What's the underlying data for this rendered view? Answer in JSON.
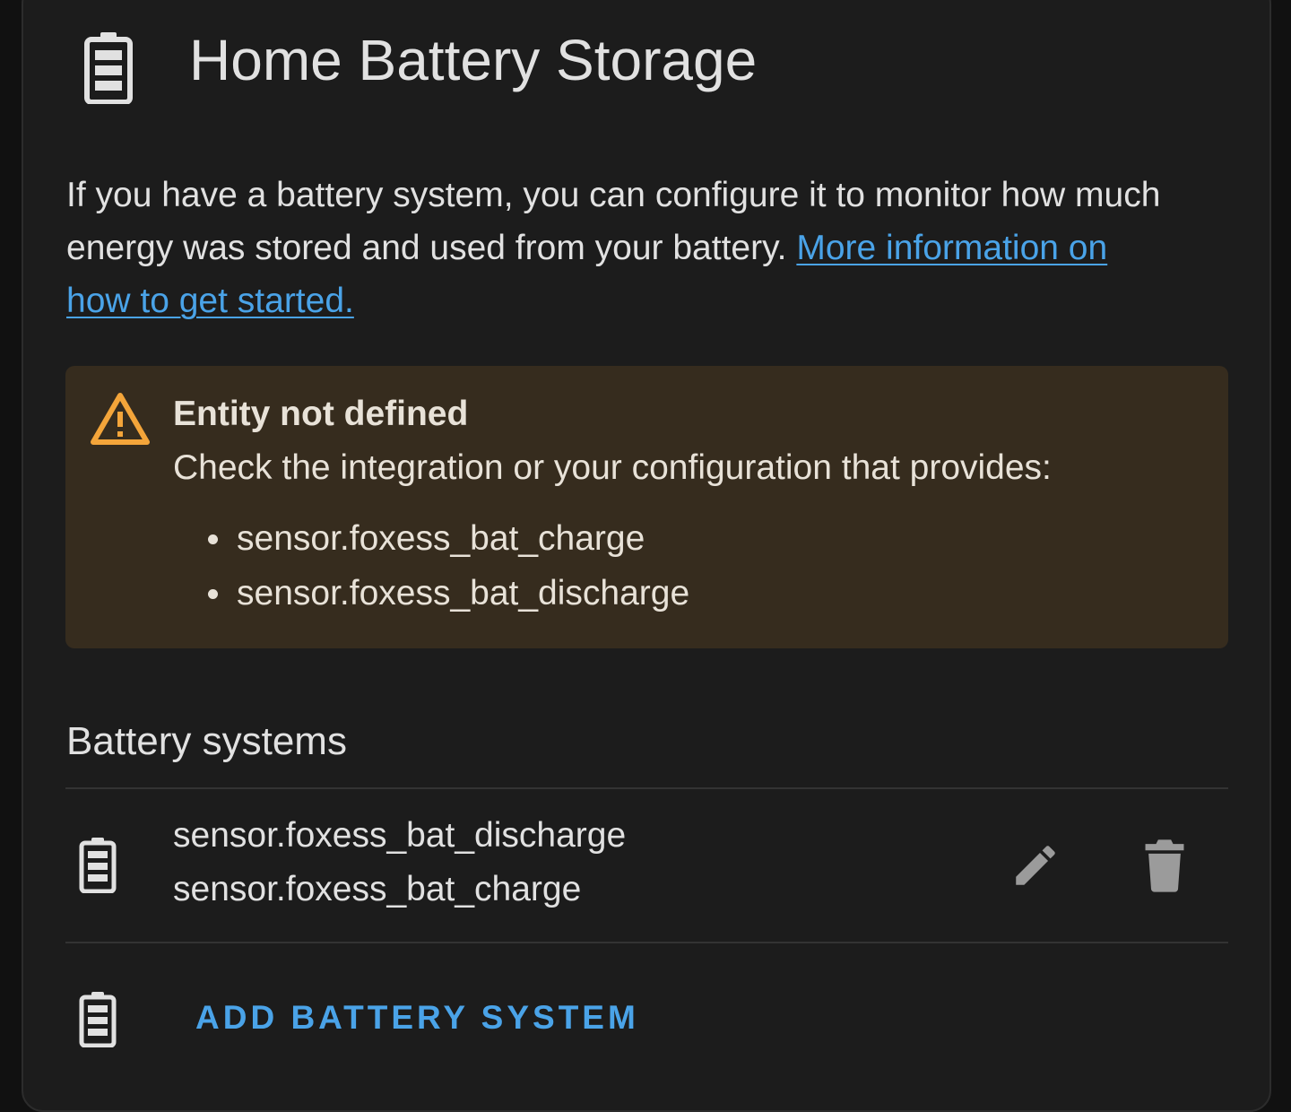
{
  "header": {
    "title": "Home Battery Storage",
    "icon": "battery-icon"
  },
  "description": {
    "text": "If you have a battery system, you can configure it to monitor how much energy was stored and used from your battery. ",
    "link_text": "More information on how to get started."
  },
  "alert": {
    "icon": "warning-icon",
    "title": "Entity not defined",
    "message": "Check the integration or your configuration that provides:",
    "entities": [
      "sensor.foxess_bat_charge",
      "sensor.foxess_bat_discharge"
    ]
  },
  "battery_systems": {
    "title": "Battery systems",
    "items": [
      {
        "icon": "battery-icon",
        "discharge_entity": "sensor.foxess_bat_discharge",
        "charge_entity": "sensor.foxess_bat_charge",
        "actions": [
          "edit-icon",
          "delete-icon"
        ]
      }
    ],
    "add_label": "ADD BATTERY SYSTEM",
    "add_icon": "battery-icon"
  },
  "colors": {
    "background": "#1c1c1c",
    "text": "#e1e1e1",
    "link": "#4aa3e8",
    "alert_background": "#362c1e",
    "warning": "#f4a53a",
    "icon": "#e1e1e1",
    "action_icon": "#9b9b9b"
  }
}
